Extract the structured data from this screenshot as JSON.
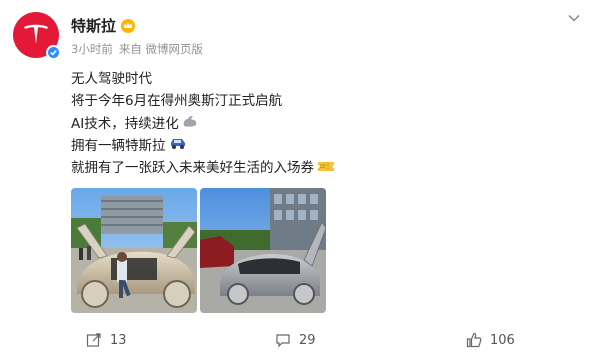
{
  "post": {
    "author": "特斯拉",
    "time": "3小时前",
    "source": "来自 微博网页版",
    "lines": [
      "无人驾驶时代",
      "将于今年6月在得州奥斯汀正式启航",
      "AI技术，持续进化",
      "拥有一辆特斯拉",
      "就拥有了一张跃入未来美好生活的入场券"
    ],
    "line_emojis": [
      "",
      "",
      "💪",
      "🚙",
      "🎫"
    ]
  },
  "images": [
    {
      "name": "tesla-cybercab-open-doors"
    },
    {
      "name": "tesla-cybercab-parked"
    }
  ],
  "actions": {
    "share_count": "13",
    "comment_count": "29",
    "like_count": "106"
  },
  "icons": [
    "tesla-logo-icon",
    "verified-icon",
    "crown-badge-icon",
    "chevron-down-icon",
    "share-icon",
    "comment-icon",
    "like-icon"
  ],
  "colors": {
    "brand_red": "#e31937",
    "verified_blue": "#2a8cff",
    "meta_gray": "#939393"
  }
}
